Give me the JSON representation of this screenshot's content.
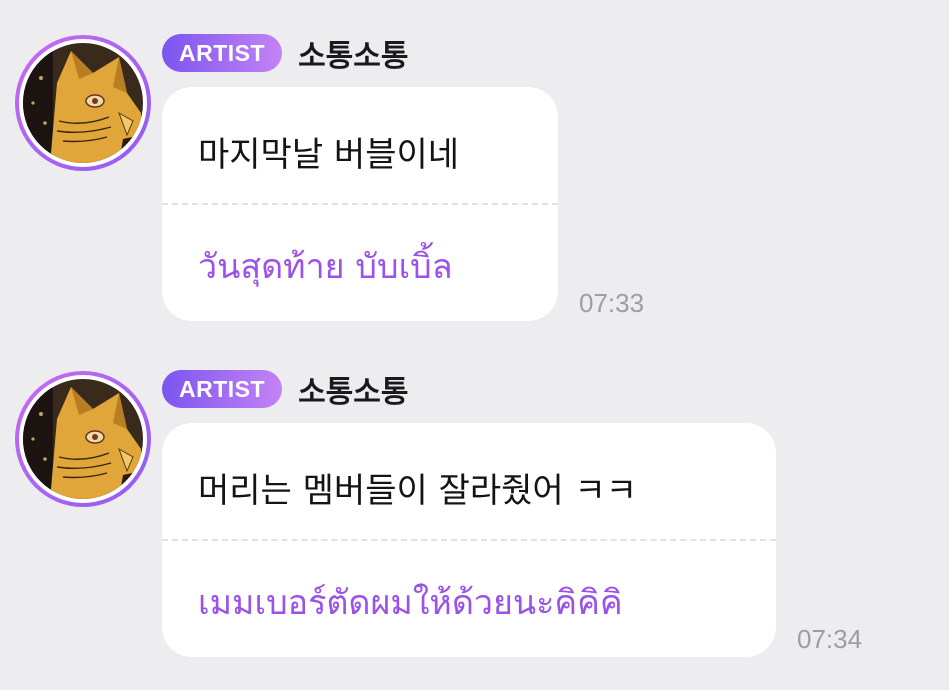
{
  "colors": {
    "background": "#ededef",
    "bubble": "#ffffff",
    "translation_text": "#9a52e8",
    "badge_gradient_start": "#7b55f0",
    "badge_gradient_end": "#c483f5",
    "timestamp": "#9d9da3"
  },
  "messages": [
    {
      "avatar_icon": "cat-illustration-avatar",
      "badge": "ARTIST",
      "sender": "소통소통",
      "original": "마지막날 버블이네",
      "translation": "วันสุดท้าย บับเบิ้ล",
      "time": "07:33"
    },
    {
      "avatar_icon": "cat-illustration-avatar",
      "badge": "ARTIST",
      "sender": "소통소통",
      "original": "머리는 멤버들이 잘라줬어 ㅋㅋ",
      "translation": "เมมเบอร์ตัดผมให้ด้วยนะคิคิคิ",
      "time": "07:34"
    }
  ]
}
